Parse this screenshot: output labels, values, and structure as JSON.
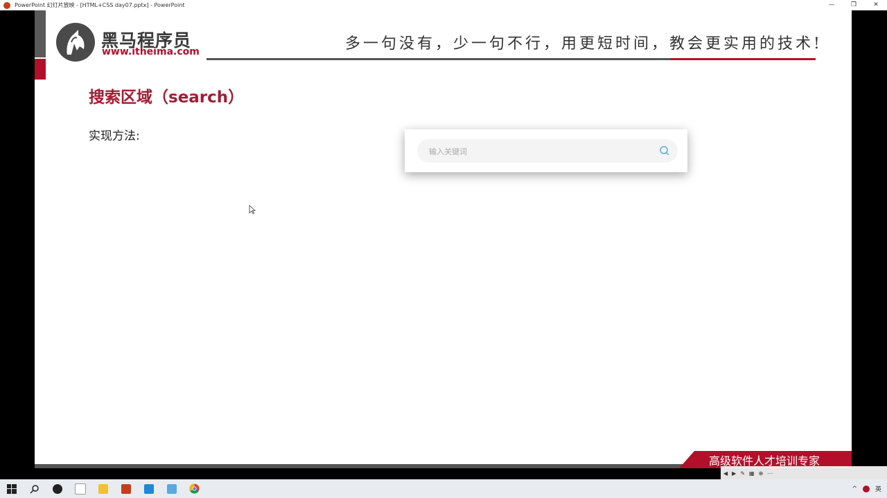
{
  "window": {
    "title": "PowerPoint 幻灯片放映 - [HTML+CSS day07.pptx] - PowerPoint",
    "controls": [
      "—",
      "❐",
      "✕"
    ]
  },
  "slide": {
    "logo_text": "黑马程序员",
    "logo_url": "www.itheima.com",
    "slogan": "多一句没有，少一句不行，用更短时间，教会更实用的技术!",
    "heading": "搜索区域（search）",
    "method_label": "实现方法:",
    "search": {
      "placeholder": "输入关键词"
    },
    "footer_text": "高级软件人才培训专家"
  },
  "colors": {
    "brand_red": "#b2102a",
    "heading_red": "#a11d33",
    "dark_grey": "#555555"
  },
  "taskbar": {
    "items": [
      "start-icon",
      "search-icon",
      "app-icon",
      "typora-icon",
      "file-explorer-icon",
      "powerpoint-icon",
      "vscode-icon",
      "notepad-icon",
      "chrome-icon"
    ],
    "tray": [
      "^",
      "英"
    ]
  }
}
